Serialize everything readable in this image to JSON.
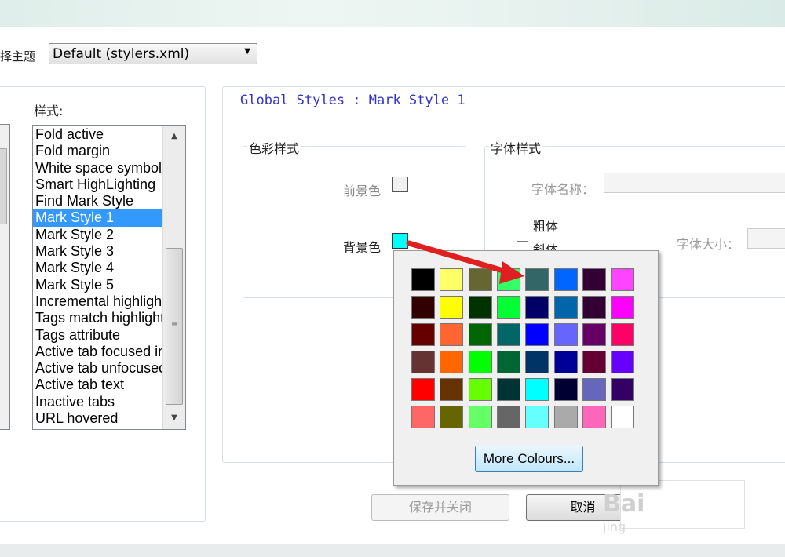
{
  "theme": {
    "label": "择主题",
    "selected": "Default (stylers.xml)"
  },
  "styles_label": "样式:",
  "style_items": [
    "Fold active",
    "Fold margin",
    "White space symbol",
    "Smart HighLighting",
    "Find Mark Style",
    "Mark Style 1",
    "Mark Style 2",
    "Mark Style 3",
    "Mark Style 4",
    "Mark Style 5",
    "Incremental highlight",
    "Tags match highlight",
    "Tags attribute",
    "Active tab focused indicator",
    "Active tab unfocused indicator",
    "Active tab text",
    "Inactive tabs",
    "URL hovered"
  ],
  "selected_style_index": 5,
  "style_title": "Global Styles : Mark Style 1",
  "color_group": {
    "title": "色彩样式",
    "foreground_label": "前景色",
    "background_label": "背景色",
    "foreground_color": "#f0f0f0",
    "background_color": "#00ffff"
  },
  "font_group": {
    "title": "字体样式",
    "font_name_label": "字体名称：",
    "bold_label": "粗体",
    "italic_label": "斜体",
    "font_size_label": "字体大小："
  },
  "color_palette": [
    [
      "#000000",
      "#ffff66",
      "#666633",
      "#33ff66",
      "#336666",
      "#0066ff",
      "#330033",
      "#ff44ff"
    ],
    [
      "#330000",
      "#ffff00",
      "#003300",
      "#00ff33",
      "#000066",
      "#0066aa",
      "#330033",
      "#ff00ff"
    ],
    [
      "#660000",
      "#ff6633",
      "#006600",
      "#006666",
      "#0000ff",
      "#6666ff",
      "#660066",
      "#ff0066"
    ],
    [
      "#663333",
      "#ff6600",
      "#00ff00",
      "#006633",
      "#003366",
      "#000099",
      "#660033",
      "#6600ff"
    ],
    [
      "#ff0000",
      "#663300",
      "#66ff00",
      "#003333",
      "#00ffff",
      "#000033",
      "#6666bb",
      "#330066"
    ],
    [
      "#ff6666",
      "#666600",
      "#66ff66",
      "#666666",
      "#66ffff",
      "#aaaaaa",
      "#ff66bb",
      "#ffffff"
    ]
  ],
  "more_colours_label": "More Colours...",
  "buttons": {
    "save_close": "保存并关闭",
    "cancel": "取消"
  },
  "watermark": {
    "text": "Bai",
    "sub": "jing"
  },
  "arrow_color": "#e02020"
}
